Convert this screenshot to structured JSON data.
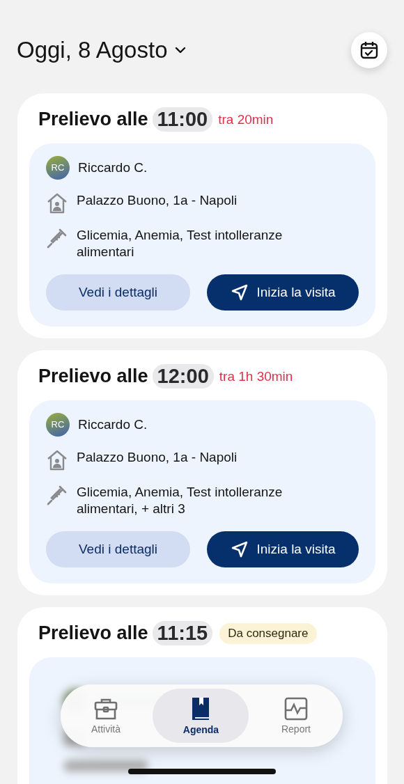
{
  "header": {
    "title": "Oggi, 8 Agosto"
  },
  "visits": [
    {
      "title": "Prelievo alle",
      "time": "11:00",
      "badge": {
        "kind": "countdown",
        "text": "tra 20min"
      },
      "details": {
        "initials": "RC",
        "name": "Riccardo C.",
        "address": "Palazzo Buono, 1a - Napoli",
        "tests": "Glicemia, Anemia, Test intolleranze alimentari"
      },
      "buttons": {
        "details": "Vedi i dettagli",
        "start": "Inizia la visita"
      }
    },
    {
      "title": "Prelievo alle",
      "time": "12:00",
      "badge": {
        "kind": "countdown",
        "text": "tra 1h 30min"
      },
      "details": {
        "initials": "RC",
        "name": "Riccardo C.",
        "address": "Palazzo Buono, 1a - Napoli",
        "tests": "Glicemia, Anemia, Test intolleranze alimentari, + altri 3"
      },
      "buttons": {
        "details": "Vedi i dettagli",
        "start": "Inizia la visita"
      }
    },
    {
      "title": "Prelievo alle",
      "time": "11:15",
      "badge": {
        "kind": "status",
        "text": "Da consegnare"
      }
    }
  ],
  "tabs": [
    {
      "label": "Attività",
      "selected": false
    },
    {
      "label": "Agenda",
      "selected": true
    },
    {
      "label": "Report",
      "selected": false
    }
  ]
}
